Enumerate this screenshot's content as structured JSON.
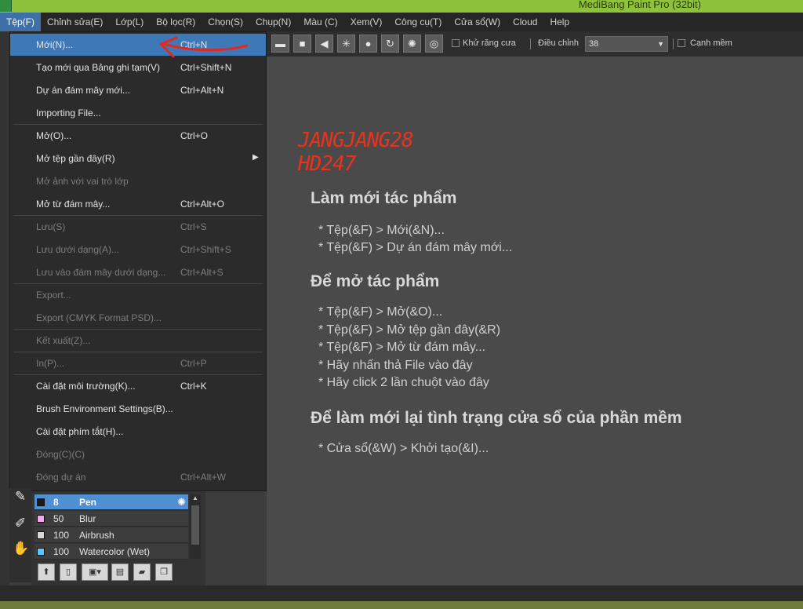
{
  "window": {
    "title": "MediBang Paint Pro (32bit)"
  },
  "menubar": {
    "items": [
      {
        "label": "Tệp(F)"
      },
      {
        "label": "Chỉnh sửa(E)"
      },
      {
        "label": "Lớp(L)"
      },
      {
        "label": "Bộ lọc(R)"
      },
      {
        "label": "Chọn(S)"
      },
      {
        "label": "Chụp(N)"
      },
      {
        "label": "Màu (C)"
      },
      {
        "label": "Xem(V)"
      },
      {
        "label": "Công cụ(T)"
      },
      {
        "label": "Cửa sổ(W)"
      },
      {
        "label": "Cloud"
      },
      {
        "label": "Help"
      }
    ]
  },
  "toolbar": {
    "antialias_label": "Khử răng cưa",
    "adjust_label": "Điều chỉnh",
    "adjust_value": "38",
    "soft_edge_label": "Cạnh mềm"
  },
  "file_menu": {
    "items": [
      {
        "label": "Mới(N)...",
        "shortcut": "Ctrl+N"
      },
      {
        "label": "Tạo mới qua Bảng ghi tạm(V)",
        "shortcut": "Ctrl+Shift+N"
      },
      {
        "label": "Dự án đám mây mới...",
        "shortcut": "Ctrl+Alt+N"
      },
      {
        "label": "Importing File...",
        "shortcut": ""
      },
      {
        "label": "Mở(O)...",
        "shortcut": "Ctrl+O"
      },
      {
        "label": "Mở tệp gần đây(R)",
        "shortcut": ""
      },
      {
        "label": "Mở ảnh với vai trò lớp",
        "shortcut": ""
      },
      {
        "label": "Mở từ đám mây...",
        "shortcut": "Ctrl+Alt+O"
      },
      {
        "label": "Lưu(S)",
        "shortcut": "Ctrl+S"
      },
      {
        "label": "Lưu dưới dạng(A)...",
        "shortcut": "Ctrl+Shift+S"
      },
      {
        "label": "Lưu vào đám mây dưới dạng...",
        "shortcut": "Ctrl+Alt+S"
      },
      {
        "label": "Export...",
        "shortcut": ""
      },
      {
        "label": "Export (CMYK Format PSD)...",
        "shortcut": ""
      },
      {
        "label": "Kết xuất(Z)...",
        "shortcut": ""
      },
      {
        "label": "In(P)...",
        "shortcut": "Ctrl+P"
      },
      {
        "label": "Cài đặt môi trường(K)...",
        "shortcut": "Ctrl+K"
      },
      {
        "label": "Brush Environment Settings(B)...",
        "shortcut": ""
      },
      {
        "label": "Cài đặt phím tắt(H)...",
        "shortcut": ""
      },
      {
        "label": "Đóng(C)(C)",
        "shortcut": ""
      },
      {
        "label": "Đóng dự án",
        "shortcut": "Ctrl+Alt+W"
      }
    ]
  },
  "watermark": {
    "line1": "JANGJANG28",
    "line2": "HD247",
    "color": "#e8331c"
  },
  "help": {
    "heading_new": "Làm mới tác phẩm",
    "new_lines": [
      "* Tệp(&F) > Mới(&N)...",
      "* Tệp(&F) > Dự án đám mây mới..."
    ],
    "heading_open": "Để mở tác phẩm",
    "open_lines": [
      "* Tệp(&F) > Mở(&O)...",
      "* Tệp(&F) > Mở tệp gần đây(&R)",
      "* Tệp(&F) > Mở từ đám mây...",
      "* Hãy nhấn thả File vào đây",
      "* Hãy click 2 lần chuột vào đây"
    ],
    "heading_reset": "Để làm mới lại tình trạng cửa sổ của phần mềm",
    "reset_lines": [
      "* Cửa sổ(&W) > Khởi tạo(&I)..."
    ]
  },
  "brushes": [
    {
      "size": "8",
      "name": "Pen",
      "color": "#1a1a1a"
    },
    {
      "size": "50",
      "name": "Blur",
      "color": "#f3a6ea"
    },
    {
      "size": "100",
      "name": "Airbrush",
      "color": "#d8d8d8"
    },
    {
      "size": "100",
      "name": "Watercolor (Wet)",
      "color": "#5fc4ff"
    }
  ]
}
